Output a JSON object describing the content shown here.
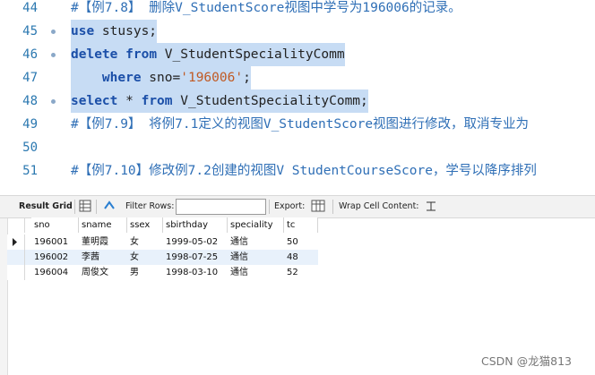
{
  "editor": {
    "lines": [
      {
        "num": "44",
        "parts": [
          {
            "t": "#【例7.8】 删除V_StudentScore视图中学号为196006的记录。",
            "c": "cmt"
          }
        ],
        "dot": false,
        "selected": false
      },
      {
        "num": "45",
        "parts": [
          {
            "t": "use",
            "c": "kw"
          },
          {
            "t": " stusys;",
            "c": ""
          }
        ],
        "dot": true,
        "selected": true
      },
      {
        "num": "46",
        "parts": [
          {
            "t": "delete",
            "c": "kw"
          },
          {
            "t": " ",
            "c": ""
          },
          {
            "t": "from",
            "c": "kw"
          },
          {
            "t": " V_StudentSpecialityComm",
            "c": ""
          }
        ],
        "dot": true,
        "selected": true
      },
      {
        "num": "47",
        "parts": [
          {
            "t": "    ",
            "c": ""
          },
          {
            "t": "where",
            "c": "kw"
          },
          {
            "t": " sno=",
            "c": ""
          },
          {
            "t": "'196006'",
            "c": "str"
          },
          {
            "t": ";",
            "c": ""
          }
        ],
        "dot": false,
        "selected": true
      },
      {
        "num": "48",
        "parts": [
          {
            "t": "select",
            "c": "kw"
          },
          {
            "t": " * ",
            "c": ""
          },
          {
            "t": "from",
            "c": "kw"
          },
          {
            "t": " V_StudentSpecialityComm;",
            "c": ""
          }
        ],
        "dot": true,
        "selected": true
      },
      {
        "num": "49",
        "parts": [
          {
            "t": "#【例7.9】 将例7.1定义的视图V_StudentScore视图进行修改，取消专业为",
            "c": "cmt"
          }
        ],
        "dot": false,
        "selected": false
      },
      {
        "num": "50",
        "parts": [],
        "dot": false,
        "selected": false
      },
      {
        "num": "51",
        "parts": [
          {
            "t": "#【例7.10】修改例7.2创建的视图V_StudentCourseScore，学号以降序排列",
            "c": "cmt"
          }
        ],
        "dot": false,
        "selected": false
      }
    ]
  },
  "toolbar": {
    "result_grid": "Result Grid",
    "filter_rows": "Filter Rows:",
    "export": "Export:",
    "wrap_cell": "Wrap Cell Content:"
  },
  "grid": {
    "columns": [
      "sno",
      "sname",
      "ssex",
      "sbirthday",
      "speciality",
      "tc"
    ],
    "rows": [
      [
        "196001",
        "董明霞",
        "女",
        "1999-05-02",
        "通信",
        "50"
      ],
      [
        "196002",
        "李茜",
        "女",
        "1998-07-25",
        "通信",
        "48"
      ],
      [
        "196004",
        "周俊文",
        "男",
        "1998-03-10",
        "通信",
        "52"
      ]
    ]
  },
  "watermark": "CSDN @龙猫813"
}
